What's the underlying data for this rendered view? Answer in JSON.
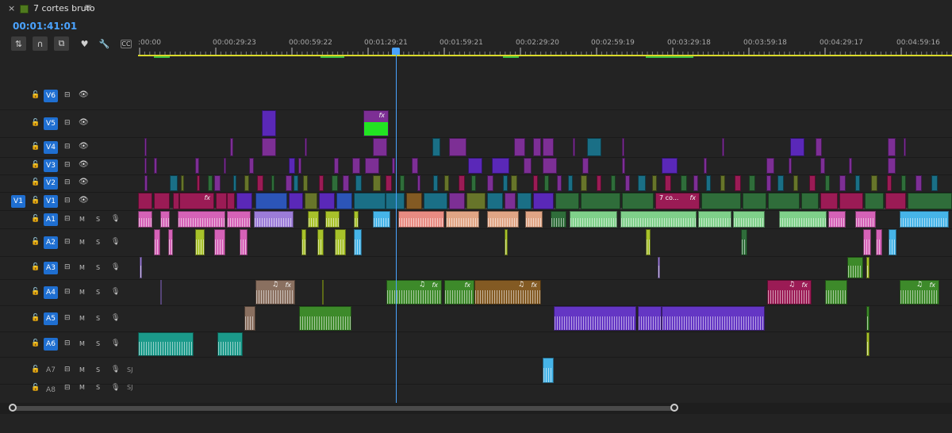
{
  "tab": {
    "close_glyph": "×",
    "title": "7 cortes bruto",
    "menu_glyph": "≡",
    "swatch_color": "#4f7a1e"
  },
  "header": {
    "timecode": "00:01:41:01"
  },
  "toolbar": [
    {
      "name": "insert-overwrite-toggle-icon",
      "glyph": "⇅",
      "boxed": true
    },
    {
      "name": "snap-magnet-icon",
      "glyph": "∩",
      "boxed": true
    },
    {
      "name": "linked-selection-icon",
      "glyph": "⧉",
      "boxed": true
    },
    {
      "name": "add-marker-icon",
      "glyph": "♥",
      "boxed": false
    },
    {
      "name": "timeline-settings-wrench-icon",
      "glyph": "🔧",
      "boxed": false
    },
    {
      "name": "captions-icon",
      "glyph": "CC",
      "boxed": false
    }
  ],
  "ruler": {
    "labels": [
      ":00:00",
      "00:00:29:23",
      "00:00:59:22",
      "00:01:29:21",
      "00:01:59:21",
      "00:02:29:20",
      "00:02:59:19",
      "00:03:29:18",
      "00:03:59:18",
      "00:04:29:17",
      "00:04:59:16"
    ]
  },
  "tracks": [
    {
      "id": "V6",
      "kind": "video",
      "lock": "🔓",
      "sync": "⊟",
      "eye": "👁"
    },
    {
      "id": "V5",
      "kind": "video",
      "lock": "🔓",
      "sync": "⊟",
      "eye": "👁"
    },
    {
      "id": "V4",
      "kind": "video",
      "lock": "🔓",
      "sync": "⊟",
      "eye": "👁"
    },
    {
      "id": "V3",
      "kind": "video",
      "lock": "🔓",
      "sync": "⊟",
      "eye": "👁"
    },
    {
      "id": "V2",
      "kind": "video",
      "lock": "🔓",
      "sync": "⊟",
      "eye": "👁"
    },
    {
      "id": "V1",
      "kind": "video",
      "source": "V1",
      "lock": "🔓",
      "sync": "⊟",
      "eye": "👁"
    },
    {
      "id": "A1",
      "kind": "audio",
      "lock": "🔓",
      "sync": "⊟",
      "m": "M",
      "s": "S",
      "mic": "🎙"
    },
    {
      "id": "A2",
      "kind": "audio",
      "lock": "🔓",
      "sync": "⊟",
      "m": "M",
      "s": "S",
      "mic": "🎙"
    },
    {
      "id": "A3",
      "kind": "audio",
      "lock": "🔓",
      "sync": "⊟",
      "m": "M",
      "s": "S",
      "mic": "🎙"
    },
    {
      "id": "A4",
      "kind": "audio",
      "lock": "🔓",
      "sync": "⊟",
      "m": "M",
      "s": "S",
      "mic": "🎙"
    },
    {
      "id": "A5",
      "kind": "audio",
      "lock": "🔓",
      "sync": "⊟",
      "m": "M",
      "s": "S",
      "mic": "🎙"
    },
    {
      "id": "A6",
      "kind": "audio",
      "lock": "🔓",
      "sync": "⊟",
      "m": "M",
      "s": "S",
      "mic": "🎙"
    },
    {
      "id": "A7",
      "kind": "audio",
      "off": true,
      "lock": "🔓",
      "sync": "⊟",
      "m": "M",
      "s": "S",
      "mic": "🎙",
      "extra": "SJ"
    },
    {
      "id": "A8",
      "kind": "audio",
      "off": true,
      "lock": "🔓",
      "sync": "⊟",
      "m": "M",
      "s": "S",
      "mic": "🎙",
      "extra": "SJ"
    }
  ],
  "clip_texts": {
    "named_clip": "7 co...",
    "fx": "fx",
    "music": "♫"
  },
  "colors": {
    "violet": "#7d2f95",
    "purple_v": "#5a28b8",
    "teal": "#1a6f86",
    "magenta": "#9b1b55",
    "green_bright": "#22e322",
    "olive": "#67752a",
    "blue_v": "#2c55b8",
    "dkgreen": "#2f6d3a",
    "pink": "#d562b7",
    "salmon": "#e88b82",
    "lavender": "#9c7cd8",
    "lime": "#a8c22a",
    "skyblue": "#46b4e8",
    "peach": "#e0a585",
    "mint": "#7fd08a",
    "tan": "#8a7060",
    "brown": "#835a23",
    "agreen": "#3d8a2a",
    "apurple": "#6436c4",
    "aqua": "#1b9a8a",
    "playhead": "#4aa3ff",
    "selected_track": "#1f6fd1"
  }
}
